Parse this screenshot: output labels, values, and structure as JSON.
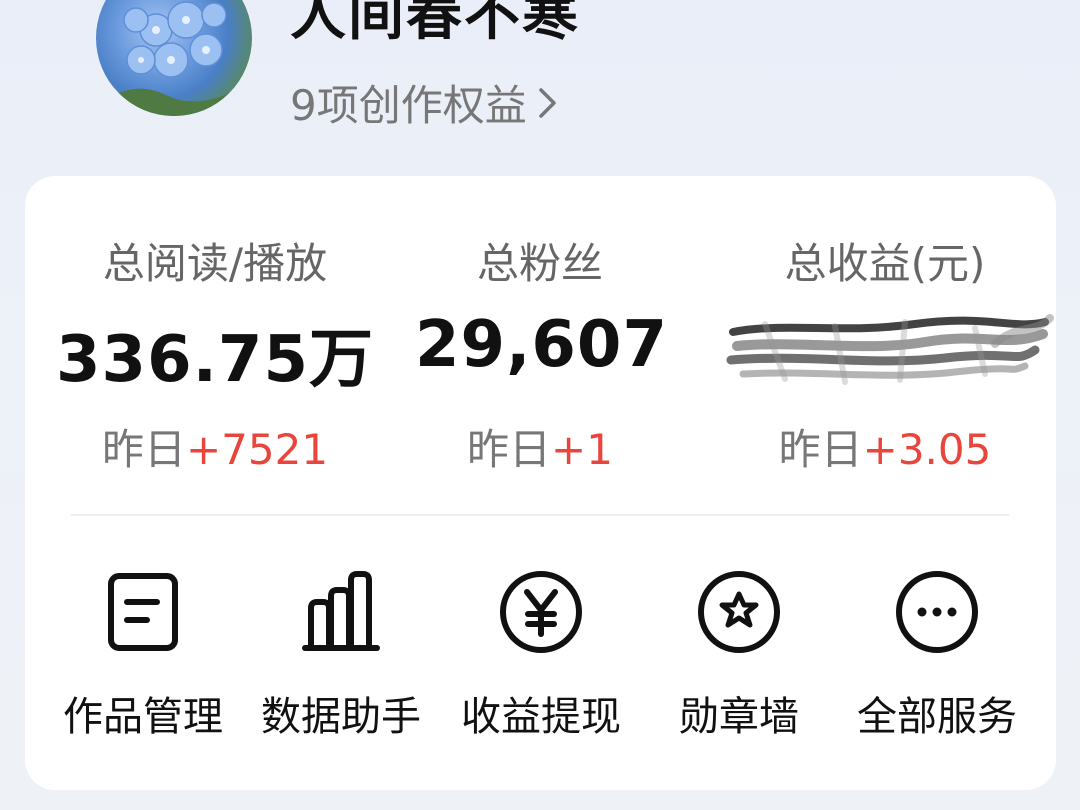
{
  "profile": {
    "username": "人间春不寒",
    "rights_text": "9项创作权益",
    "avatar_icon": "flower-avatar"
  },
  "stats": [
    {
      "label": "总阅读/播放",
      "value": "336.75万",
      "delta_prefix": "昨日",
      "delta": "+7521"
    },
    {
      "label": "总粉丝",
      "value": "29,607",
      "delta_prefix": "昨日",
      "delta": "+1"
    },
    {
      "label": "总收益(元)",
      "value": "",
      "delta_prefix": "昨日",
      "delta": "+3.05"
    }
  ],
  "services": [
    {
      "label": "作品管理",
      "icon": "document-icon"
    },
    {
      "label": "数据助手",
      "icon": "bar-chart-icon"
    },
    {
      "label": "收益提现",
      "icon": "yen-circle-icon"
    },
    {
      "label": "勋章墙",
      "icon": "medal-star-icon"
    },
    {
      "label": "全部服务",
      "icon": "more-circle-icon"
    }
  ],
  "colors": {
    "accent_red": "#e8453c",
    "text_primary": "#111111",
    "text_secondary": "#777777",
    "card_bg": "#ffffff",
    "page_bg": "#edf1f8"
  }
}
